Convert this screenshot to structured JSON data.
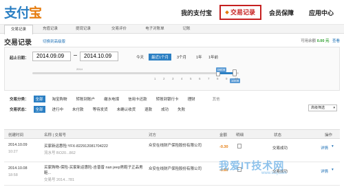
{
  "header": {
    "logo_main": "支付",
    "logo_accent": "宝",
    "nav": [
      "我的支付宝",
      "交易记录",
      "会员保障",
      "应用中心"
    ]
  },
  "subtabs": [
    "交易记录",
    "充值记录",
    "提现记录",
    "交易评价",
    "电子对账单",
    "记账"
  ],
  "page": {
    "title": "交易记录",
    "switch_link": "切换到高级版",
    "balance_label": "可用余额",
    "balance_value": "0.00 元",
    "balance_link": "查看"
  },
  "filter": {
    "date_label": "起止日期：",
    "start_date": "2014.09.09",
    "end_date": "2014.10.09",
    "quick_ranges": [
      "今天",
      "最近1个月",
      "3个月",
      "1年",
      "1年前"
    ],
    "quick_selected": "最近1个月",
    "year_tag": "2014",
    "slider_ticks": [
      "1",
      "2",
      "3",
      "4",
      "5",
      "6",
      "7",
      "8",
      "9",
      "10"
    ],
    "slider_start_badge": "09/09",
    "slider_end_badge": "10/09",
    "category_label": "交易分类：",
    "categories": [
      "全部",
      "淘宝购物",
      "转账到账户",
      "缴水电煤",
      "信用卡还款",
      "转账到银行卡",
      "理财"
    ],
    "category_more": "其他",
    "status_label": "交易状态：",
    "statuses": [
      "全部",
      "进行中",
      "未付款",
      "等待发货",
      "未确认收货",
      "退款",
      "成功",
      "失败"
    ],
    "advanced_select": "高级筛选"
  },
  "table": {
    "headers": [
      "创建时间",
      "名称 | 交易号",
      "对方",
      "金额",
      "明细",
      "状态",
      "操作"
    ],
    "rows": [
      {
        "date": "2014.10.09",
        "time": "10:27",
        "name": "买家新运惠险:YFX-822912081704222",
        "trade_no": "流水号 BO20...862",
        "party": "众安在线财产保险股份有限公司",
        "amount": "-0.30",
        "status": "交易成功",
        "action": "详情"
      },
      {
        "date": "2014.10.08",
        "time": "18:58",
        "name": "买家购物-保险-买家新运惠险-吉普普 nan jeep男鞋子正品男鞋...",
        "trade_no": "交易号 2014...781",
        "party": "众安在线财产保险股份有限公司",
        "amount": "-0.80",
        "status": "交易成功",
        "action": "详情"
      }
    ]
  },
  "watermark": {
    "line1": "我爱IT技术网",
    "line2": "www.52ij.com"
  }
}
